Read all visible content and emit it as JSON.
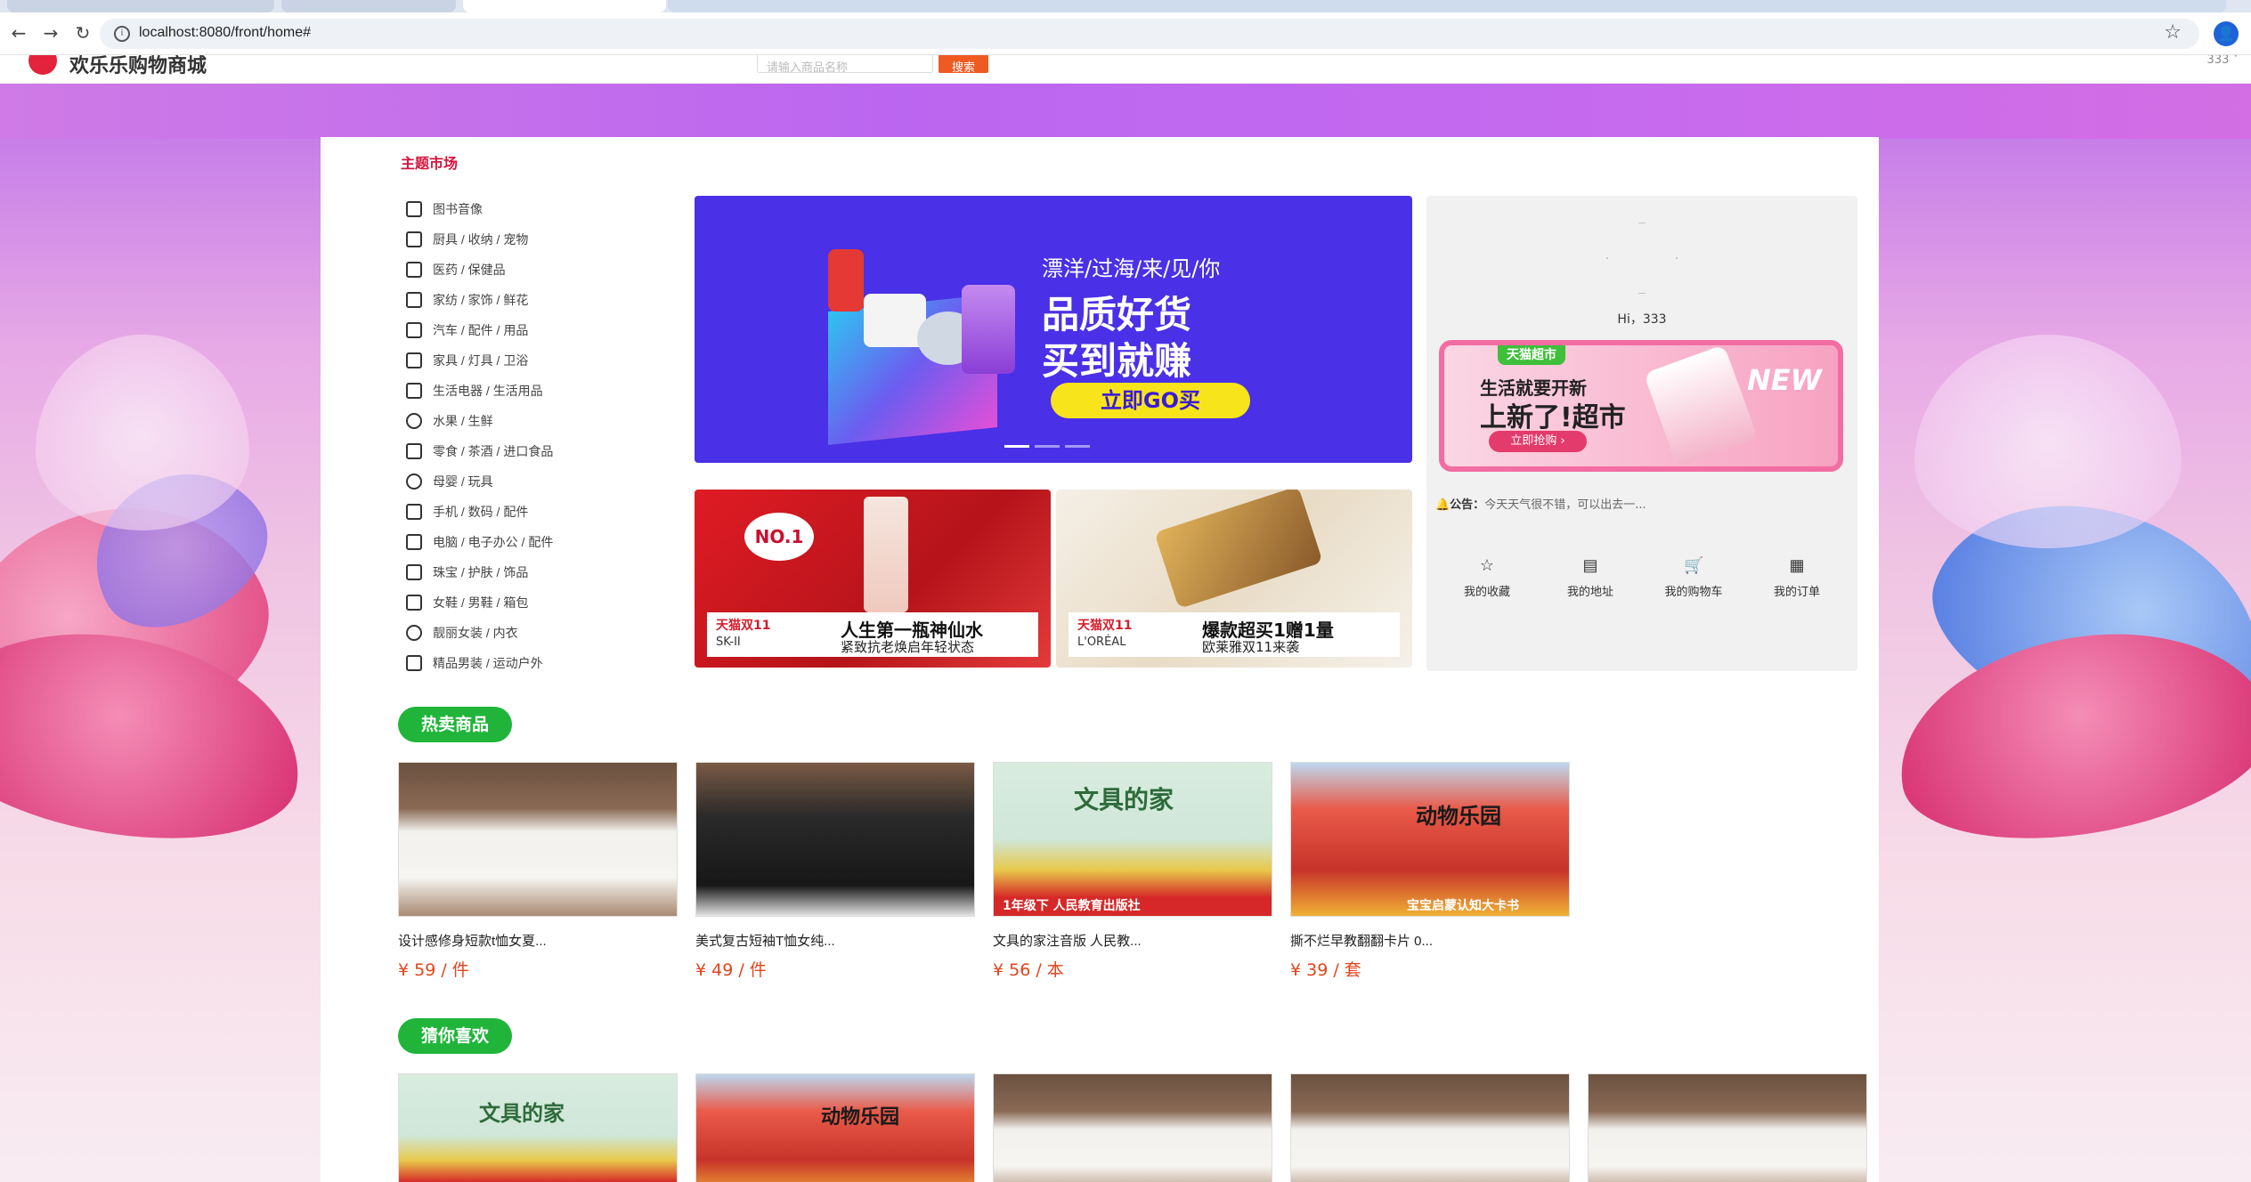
{
  "browser": {
    "url": "localhost:8080/front/home#",
    "back_icon": "←",
    "forward_icon": "→",
    "reload_icon": "↻",
    "star_icon": "☆",
    "profile_icon": "👤"
  },
  "site": {
    "name": "欢乐乐购物商城",
    "search_placeholder": "请输入商品名称",
    "search_button": "搜索",
    "user_label": "333 ˅"
  },
  "market": {
    "title": "主题市场",
    "categories": [
      "图书音像",
      "厨具 / 收纳 / 宠物",
      "医药 / 保健品",
      "家纺 / 家饰 / 鲜花",
      "汽车 / 配件 / 用品",
      "家具 / 灯具 / 卫浴",
      "生活电器 / 生活用品",
      "水果 / 生鲜",
      "零食 / 茶酒 / 进口食品",
      "母婴 / 玩具",
      "手机 / 数码 / 配件",
      "电脑 / 电子办公 / 配件",
      "珠宝 / 护肤 / 饰品",
      "女鞋 / 男鞋 / 箱包",
      "靓丽女装 / 内衣",
      "精品男装 / 运动户外"
    ]
  },
  "banner": {
    "line1": "漂洋/过海/来/见/你",
    "line2": "品质好货",
    "line3": "买到就赚",
    "cta": "立即GO买",
    "active_slide": 1,
    "slide_count": 3
  },
  "sub_banners": [
    {
      "brand": "天猫双11",
      "brand2": "SK-II",
      "slogan": "人生第一瓶神仙水",
      "slogan2": "紧致抗老焕启年轻状态",
      "badge": "NO.1"
    },
    {
      "brand": "天猫双11",
      "brand2": "L'ORÉAL",
      "slogan": "爆款超买1赠1量",
      "slogan2": "欧莱雅双11来袭"
    }
  ],
  "user_panel": {
    "greeting": "Hi，333",
    "promo_tag": "天猫超市",
    "promo_t1": "生活就要开新",
    "promo_t2": "上新了!超市",
    "promo_btn": "立即抢购 ›",
    "promo_new": "NEW",
    "notice_label": "🔔公告：",
    "notice_text": "今天天气很不错，可以出去一...",
    "quick": [
      {
        "label": "我的收藏",
        "icon": "☆"
      },
      {
        "label": "我的地址",
        "icon": "▤"
      },
      {
        "label": "我的购物车",
        "icon": "🛒"
      },
      {
        "label": "我的订单",
        "icon": "▦"
      }
    ]
  },
  "hot": {
    "title": "热卖商品",
    "items": [
      {
        "name": "设计感修身短款t恤女夏...",
        "price": "¥ 59 / 件"
      },
      {
        "name": "美式复古短袖T恤女纯...",
        "price": "¥ 49 / 件"
      },
      {
        "name": "文具的家注音版 人民教...",
        "price": "¥ 56 / 本",
        "img_title": "文具的家",
        "img_bottom": "1年级下 人民教育出版社"
      },
      {
        "name": "撕不烂早教翻翻卡片 0...",
        "price": "¥ 39 / 套",
        "img_title": "动物乐园",
        "img_bottom": "宝宝启蒙认知大卡书"
      }
    ]
  },
  "guess": {
    "title": "猜你喜欢",
    "img_title_book": "文具的家",
    "img_title_cards": "动物乐园"
  },
  "colors": {
    "accent_red": "#d5143b",
    "price": "#e2441b",
    "pill_green": "#20b53a",
    "search_btn": "#ef5a23"
  }
}
